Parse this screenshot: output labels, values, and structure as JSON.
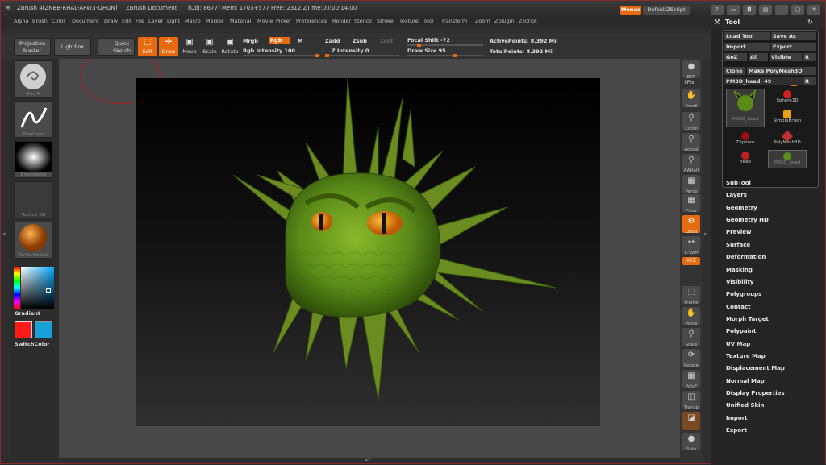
{
  "title": {
    "app": "ZBrush 4[ZNBB-KHAL-AFW3-QHON]",
    "doc": "ZBrush Document",
    "stats": "[Obj: 8677]  Mem: 1703+577  Free: 2312  ZTime:00:00:14.00"
  },
  "topright": {
    "menus": "Menus",
    "script": "DefaultZScript"
  },
  "menubar": [
    "Alpha",
    "Brush",
    "Color",
    "Document",
    "Draw",
    "Edit",
    "File",
    "Layer",
    "Light",
    "Macro",
    "Marker",
    "Material",
    "Movie",
    "Picker",
    "Preferences",
    "Render",
    "Stencil",
    "Stroke",
    "Texture",
    "Tool",
    "Transform",
    "Zoom",
    "Zplugin",
    "Zscript"
  ],
  "toolbar": {
    "projection_master": "Projection Master",
    "lightbox": "LightBox",
    "quick_sketch": "Quick Sketch",
    "modes": [
      "Edit",
      "Draw",
      "Move",
      "Scale",
      "Rotate"
    ],
    "mrgb": "Mrgb",
    "rgb": "Rgb",
    "m": "M",
    "zadd": "Zadd",
    "zsub": "Zsub",
    "zcut": "Zcut",
    "rgb_intensity": "Rgb Intensity 100",
    "z_intensity": "Z Intensity 0",
    "focal_shift": "Focal Shift -72",
    "draw_size": "Draw Size 95",
    "active_points": "ActivePoints: 8.392 Mil",
    "total_points": "TotalPoints: 8.392 Mil"
  },
  "left_shelf": {
    "brush": "Pen A",
    "stroke": "FreeHand",
    "alpha": "BrushAlpha",
    "texture": "Texture Off",
    "material": "ReflectYellow",
    "gradient": "Gradient",
    "switch_color": "SwitchColor",
    "main_color": "#ff1a1a",
    "secondary_color": "#1aa0d8"
  },
  "right_shelf": [
    "BPR",
    "SPix",
    "Scroll",
    "Zoom",
    "Actual",
    "AAHalf",
    "Persp",
    "Floor",
    "Local",
    "L.Sym",
    "XYZ",
    "Frame",
    "Move",
    "Scale",
    "Rotate",
    "PolyF",
    "Transp",
    "Ghost",
    "Solo"
  ],
  "tool_panel": {
    "title": "Tool",
    "buttons": [
      "Load Tool",
      "Save As",
      "Import",
      "Export",
      "GoZ",
      "All",
      "Visible",
      "R",
      "Clone",
      "Make PolyMesh3D"
    ],
    "current": "PM3D_head. 49",
    "current_r": "R",
    "tools": [
      "PM3D_head",
      "Sphere3D",
      "SimpleBrush",
      "ZSphere",
      "PolyMesh3D",
      "head",
      "PM3D_head"
    ]
  },
  "tool_menu": [
    "SubTool",
    "Layers",
    "Geometry",
    "Geometry HD",
    "Preview",
    "Surface",
    "Deformation",
    "Masking",
    "Visibility",
    "Polygroups",
    "Contact",
    "Morph Target",
    "Polypaint",
    "UV Map",
    "Texture Map",
    "Displacement Map",
    "Normal Map",
    "Display Properties",
    "Unified Skin",
    "Import",
    "Export"
  ],
  "colors": {
    "accent": "#e86a10",
    "model": "#6a9a1a",
    "eye": "#e0900a"
  }
}
